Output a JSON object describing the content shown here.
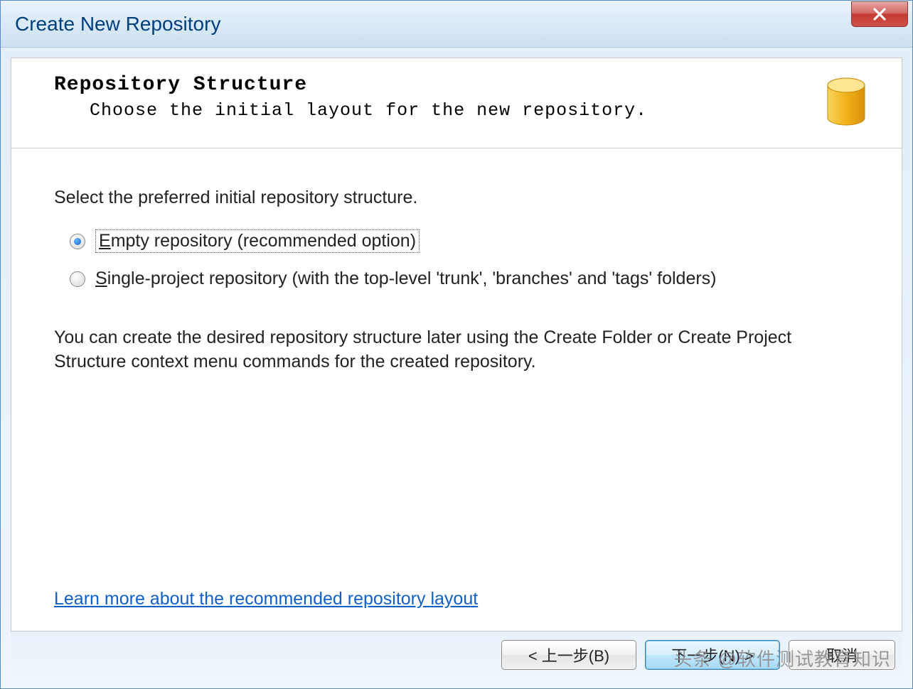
{
  "window": {
    "title": "Create New Repository"
  },
  "header": {
    "heading": "Repository Structure",
    "subheading": "Choose the initial layout for the new repository."
  },
  "body": {
    "instruction": "Select the preferred initial repository structure.",
    "options": {
      "empty": {
        "prefix": "E",
        "rest": "mpty repository (recommended option)",
        "selected": true
      },
      "single": {
        "prefix": "S",
        "rest": "ingle-project repository (with the top-level 'trunk', 'branches' and 'tags' folders)",
        "selected": false
      }
    },
    "note": "You can create the desired repository structure later using the Create Folder or Create Project Structure context menu commands for the created repository.",
    "link": "Learn more about the recommended repository layout"
  },
  "buttons": {
    "back": "< 上一步(B)",
    "next": "下一步(N) >",
    "cancel": "取消"
  },
  "watermark": "头条 @软件测试教育知识"
}
